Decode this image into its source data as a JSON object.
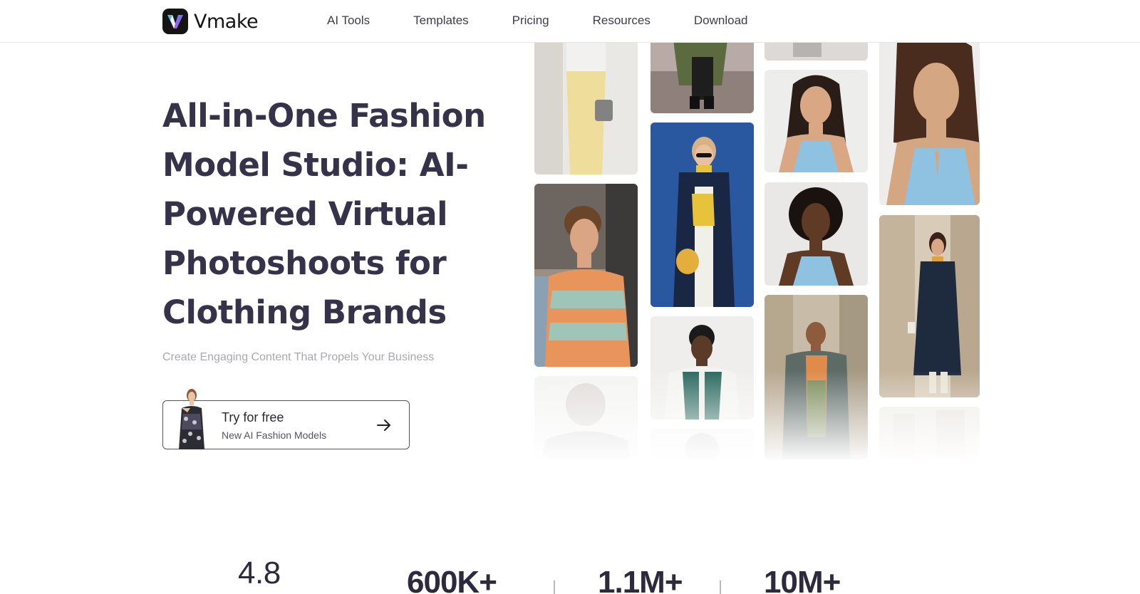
{
  "brand": {
    "name": "Vmake",
    "logo_icon": "vmake-v-logo"
  },
  "nav": {
    "items": [
      {
        "label": "AI Tools"
      },
      {
        "label": "Templates"
      },
      {
        "label": "Pricing"
      },
      {
        "label": "Resources"
      },
      {
        "label": "Download"
      }
    ]
  },
  "hero": {
    "title": "All-in-One Fashion Model Studio: AI-Powered Virtual Photoshoots for Clothing Brands",
    "subtitle": "Create Engaging Content That Propels Your Business",
    "cta": {
      "label": "Try for free",
      "sublabel": "New AI Fashion Models",
      "icon": "arrow-right-icon"
    }
  },
  "gallery": {
    "images": [
      "model-yellow-pants",
      "model-green-coat-walking",
      "model-street-top",
      "model-woman-blue-halter-closeup",
      "model-man-curly-patterned-tee",
      "model-woman-navy-coat-blue-wall",
      "model-woman-blue-halter",
      "model-woman-curly-blue-halter",
      "model-woman-navy-trench-street",
      "model-man-green-varsity-jacket",
      "model-man-green-jacket-street",
      "model-man-faded",
      "model-faded-bottom",
      "model-faded-building"
    ]
  },
  "stats": {
    "rating": "4.8",
    "values": [
      "600K+",
      "1.1M+",
      "10M+"
    ]
  },
  "colors": {
    "heading": "#35324a",
    "subtitle": "#a8a8b0",
    "accent_blue": "#2f5fa8"
  }
}
